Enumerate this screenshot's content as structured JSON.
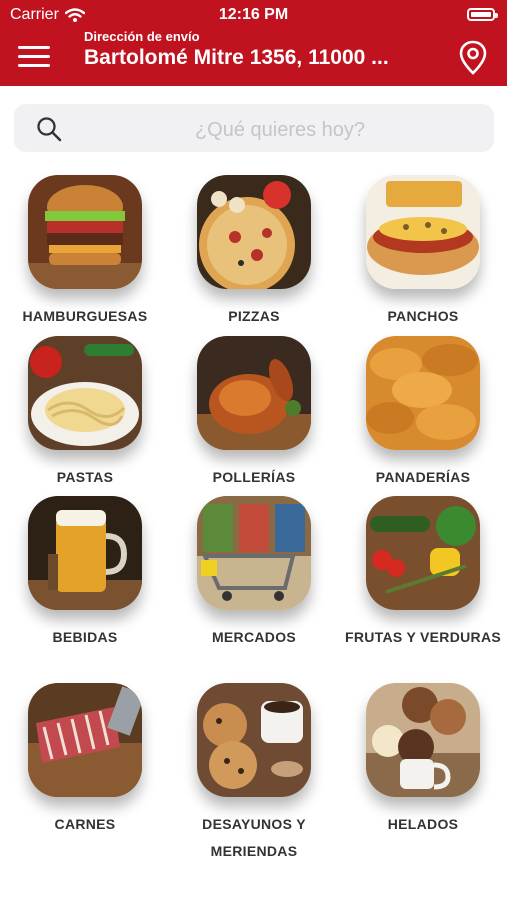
{
  "status_bar": {
    "carrier": "Carrier",
    "time": "12:16 PM"
  },
  "header": {
    "address_label": "Dirección de envío",
    "address": "Bartolomé Mitre 1356, 11000 ..."
  },
  "search": {
    "placeholder": "¿Qué quieres hoy?"
  },
  "categories": [
    {
      "label": "HAMBURGUESAS"
    },
    {
      "label": "PIZZAS"
    },
    {
      "label": "PANCHOS"
    },
    {
      "label": "PASTAS"
    },
    {
      "label": "POLLERÍAS"
    },
    {
      "label": "PANADERÍAS"
    },
    {
      "label": "BEBIDAS"
    },
    {
      "label": "MERCADOS"
    },
    {
      "label": "FRUTAS Y VERDURAS"
    },
    {
      "label": "CARNES"
    },
    {
      "label": "DESAYUNOS Y MERIENDAS"
    },
    {
      "label": "HELADOS"
    }
  ],
  "colors": {
    "header_bg": "#c1121f",
    "search_bg": "#f1f1f3",
    "label_text": "#333333"
  }
}
